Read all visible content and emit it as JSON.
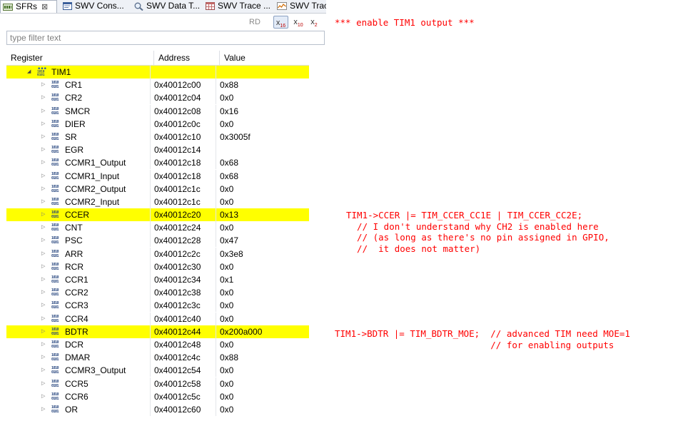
{
  "tabs": [
    {
      "label": "SFRs",
      "icon": "sfr-icon",
      "close": "⊠"
    },
    {
      "label": "SWV Cons...",
      "icon": "console-icon"
    },
    {
      "label": "SWV Data T...",
      "icon": "magnifier-icon"
    },
    {
      "label": "SWV Trace ...",
      "icon": "table-icon"
    },
    {
      "label": "SWV Trac",
      "icon": "graph-icon"
    }
  ],
  "toolbar": {
    "rd": "RD",
    "hex": {
      "base": "x",
      "sub": "16"
    },
    "dec": {
      "base": "x",
      "sub": "10"
    },
    "bin": {
      "base": "x",
      "sub": "2"
    }
  },
  "filter": {
    "placeholder": "type filter text",
    "value": ""
  },
  "columns": {
    "register": "Register",
    "address": "Address",
    "value": "Value"
  },
  "group": {
    "name": "TIM1",
    "expander": "◢"
  },
  "registers": [
    {
      "name": "CR1",
      "address": "0x40012c00",
      "value": "0x88"
    },
    {
      "name": "CR2",
      "address": "0x40012c04",
      "value": "0x0"
    },
    {
      "name": "SMCR",
      "address": "0x40012c08",
      "value": "0x16"
    },
    {
      "name": "DIER",
      "address": "0x40012c0c",
      "value": "0x0"
    },
    {
      "name": "SR",
      "address": "0x40012c10",
      "value": "0x3005f"
    },
    {
      "name": "EGR",
      "address": "0x40012c14",
      "value": ""
    },
    {
      "name": "CCMR1_Output",
      "address": "0x40012c18",
      "value": "0x68"
    },
    {
      "name": "CCMR1_Input",
      "address": "0x40012c18",
      "value": "0x68"
    },
    {
      "name": "CCMR2_Output",
      "address": "0x40012c1c",
      "value": "0x0"
    },
    {
      "name": "CCMR2_Input",
      "address": "0x40012c1c",
      "value": "0x0"
    },
    {
      "name": "CCER",
      "address": "0x40012c20",
      "value": "0x13",
      "highlight": true
    },
    {
      "name": "CNT",
      "address": "0x40012c24",
      "value": "0x0"
    },
    {
      "name": "PSC",
      "address": "0x40012c28",
      "value": "0x47"
    },
    {
      "name": "ARR",
      "address": "0x40012c2c",
      "value": "0x3e8"
    },
    {
      "name": "RCR",
      "address": "0x40012c30",
      "value": "0x0"
    },
    {
      "name": "CCR1",
      "address": "0x40012c34",
      "value": "0x1"
    },
    {
      "name": "CCR2",
      "address": "0x40012c38",
      "value": "0x0"
    },
    {
      "name": "CCR3",
      "address": "0x40012c3c",
      "value": "0x0"
    },
    {
      "name": "CCR4",
      "address": "0x40012c40",
      "value": "0x0"
    },
    {
      "name": "BDTR",
      "address": "0x40012c44",
      "value": "0x200a000",
      "highlight": true
    },
    {
      "name": "DCR",
      "address": "0x40012c48",
      "value": "0x0"
    },
    {
      "name": "DMAR",
      "address": "0x40012c4c",
      "value": "0x88"
    },
    {
      "name": "CCMR3_Output",
      "address": "0x40012c54",
      "value": "0x0"
    },
    {
      "name": "CCR5",
      "address": "0x40012c58",
      "value": "0x0"
    },
    {
      "name": "CCR6",
      "address": "0x40012c5c",
      "value": "0x0"
    },
    {
      "name": "OR",
      "address": "0x40012c60",
      "value": "0x0"
    }
  ],
  "expander_glyph": "▷",
  "register_icon_bits": [
    "1010",
    "0101"
  ],
  "notes": {
    "enable": "*** enable TIM1 output ***",
    "ccer": "TIM1->CCER |= TIM_CCER_CC1E | TIM_CCER_CC2E;\n  // I don't understand why CH2 is enabled here\n  // (as long as there's no pin assigned in GPIO,\n  //  it does not matter)",
    "bdtr": "TIM1->BDTR |= TIM_BDTR_MOE;  // advanced TIM need MOE=1\n                             // for enabling outputs"
  },
  "colors": {
    "highlight": "#ffff00",
    "annotation": "#ff0000",
    "tab_bar": "#eef1f6"
  }
}
